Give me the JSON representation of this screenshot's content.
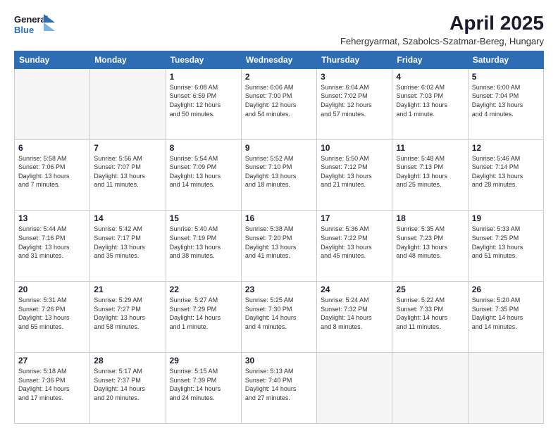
{
  "logo": {
    "line1": "General",
    "line2": "Blue"
  },
  "title": "April 2025",
  "subtitle": "Fehergyarmat, Szabolcs-Szatmar-Bereg, Hungary",
  "days_of_week": [
    "Sunday",
    "Monday",
    "Tuesday",
    "Wednesday",
    "Thursday",
    "Friday",
    "Saturday"
  ],
  "weeks": [
    [
      {
        "num": "",
        "detail": ""
      },
      {
        "num": "",
        "detail": ""
      },
      {
        "num": "1",
        "detail": "Sunrise: 6:08 AM\nSunset: 6:59 PM\nDaylight: 12 hours\nand 50 minutes."
      },
      {
        "num": "2",
        "detail": "Sunrise: 6:06 AM\nSunset: 7:00 PM\nDaylight: 12 hours\nand 54 minutes."
      },
      {
        "num": "3",
        "detail": "Sunrise: 6:04 AM\nSunset: 7:02 PM\nDaylight: 12 hours\nand 57 minutes."
      },
      {
        "num": "4",
        "detail": "Sunrise: 6:02 AM\nSunset: 7:03 PM\nDaylight: 13 hours\nand 1 minute."
      },
      {
        "num": "5",
        "detail": "Sunrise: 6:00 AM\nSunset: 7:04 PM\nDaylight: 13 hours\nand 4 minutes."
      }
    ],
    [
      {
        "num": "6",
        "detail": "Sunrise: 5:58 AM\nSunset: 7:06 PM\nDaylight: 13 hours\nand 7 minutes."
      },
      {
        "num": "7",
        "detail": "Sunrise: 5:56 AM\nSunset: 7:07 PM\nDaylight: 13 hours\nand 11 minutes."
      },
      {
        "num": "8",
        "detail": "Sunrise: 5:54 AM\nSunset: 7:09 PM\nDaylight: 13 hours\nand 14 minutes."
      },
      {
        "num": "9",
        "detail": "Sunrise: 5:52 AM\nSunset: 7:10 PM\nDaylight: 13 hours\nand 18 minutes."
      },
      {
        "num": "10",
        "detail": "Sunrise: 5:50 AM\nSunset: 7:12 PM\nDaylight: 13 hours\nand 21 minutes."
      },
      {
        "num": "11",
        "detail": "Sunrise: 5:48 AM\nSunset: 7:13 PM\nDaylight: 13 hours\nand 25 minutes."
      },
      {
        "num": "12",
        "detail": "Sunrise: 5:46 AM\nSunset: 7:14 PM\nDaylight: 13 hours\nand 28 minutes."
      }
    ],
    [
      {
        "num": "13",
        "detail": "Sunrise: 5:44 AM\nSunset: 7:16 PM\nDaylight: 13 hours\nand 31 minutes."
      },
      {
        "num": "14",
        "detail": "Sunrise: 5:42 AM\nSunset: 7:17 PM\nDaylight: 13 hours\nand 35 minutes."
      },
      {
        "num": "15",
        "detail": "Sunrise: 5:40 AM\nSunset: 7:19 PM\nDaylight: 13 hours\nand 38 minutes."
      },
      {
        "num": "16",
        "detail": "Sunrise: 5:38 AM\nSunset: 7:20 PM\nDaylight: 13 hours\nand 41 minutes."
      },
      {
        "num": "17",
        "detail": "Sunrise: 5:36 AM\nSunset: 7:22 PM\nDaylight: 13 hours\nand 45 minutes."
      },
      {
        "num": "18",
        "detail": "Sunrise: 5:35 AM\nSunset: 7:23 PM\nDaylight: 13 hours\nand 48 minutes."
      },
      {
        "num": "19",
        "detail": "Sunrise: 5:33 AM\nSunset: 7:25 PM\nDaylight: 13 hours\nand 51 minutes."
      }
    ],
    [
      {
        "num": "20",
        "detail": "Sunrise: 5:31 AM\nSunset: 7:26 PM\nDaylight: 13 hours\nand 55 minutes."
      },
      {
        "num": "21",
        "detail": "Sunrise: 5:29 AM\nSunset: 7:27 PM\nDaylight: 13 hours\nand 58 minutes."
      },
      {
        "num": "22",
        "detail": "Sunrise: 5:27 AM\nSunset: 7:29 PM\nDaylight: 14 hours\nand 1 minute."
      },
      {
        "num": "23",
        "detail": "Sunrise: 5:25 AM\nSunset: 7:30 PM\nDaylight: 14 hours\nand 4 minutes."
      },
      {
        "num": "24",
        "detail": "Sunrise: 5:24 AM\nSunset: 7:32 PM\nDaylight: 14 hours\nand 8 minutes."
      },
      {
        "num": "25",
        "detail": "Sunrise: 5:22 AM\nSunset: 7:33 PM\nDaylight: 14 hours\nand 11 minutes."
      },
      {
        "num": "26",
        "detail": "Sunrise: 5:20 AM\nSunset: 7:35 PM\nDaylight: 14 hours\nand 14 minutes."
      }
    ],
    [
      {
        "num": "27",
        "detail": "Sunrise: 5:18 AM\nSunset: 7:36 PM\nDaylight: 14 hours\nand 17 minutes."
      },
      {
        "num": "28",
        "detail": "Sunrise: 5:17 AM\nSunset: 7:37 PM\nDaylight: 14 hours\nand 20 minutes."
      },
      {
        "num": "29",
        "detail": "Sunrise: 5:15 AM\nSunset: 7:39 PM\nDaylight: 14 hours\nand 24 minutes."
      },
      {
        "num": "30",
        "detail": "Sunrise: 5:13 AM\nSunset: 7:40 PM\nDaylight: 14 hours\nand 27 minutes."
      },
      {
        "num": "",
        "detail": ""
      },
      {
        "num": "",
        "detail": ""
      },
      {
        "num": "",
        "detail": ""
      }
    ]
  ]
}
